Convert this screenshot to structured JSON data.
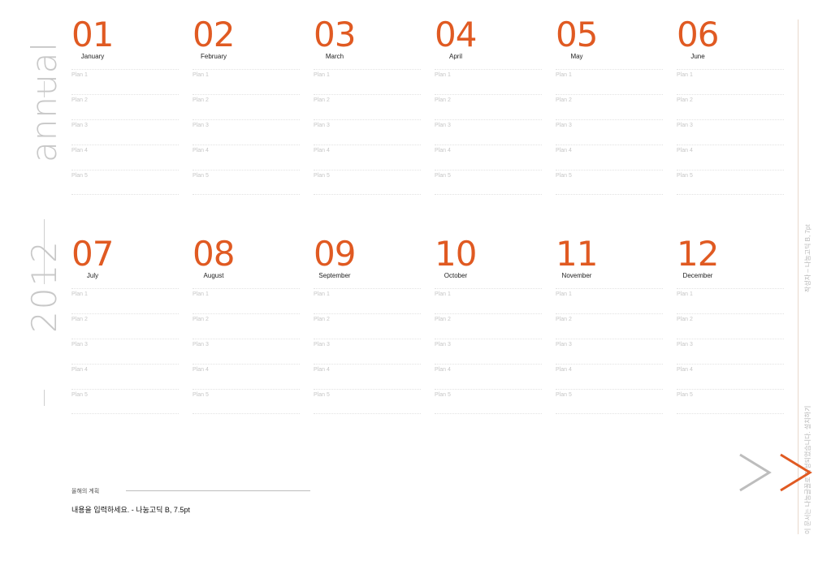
{
  "sidebar": {
    "word": "annual",
    "year": "2012"
  },
  "months": [
    {
      "num": "01",
      "name": "January"
    },
    {
      "num": "02",
      "name": "February"
    },
    {
      "num": "03",
      "name": "March"
    },
    {
      "num": "04",
      "name": "April"
    },
    {
      "num": "05",
      "name": "May"
    },
    {
      "num": "06",
      "name": "June"
    },
    {
      "num": "07",
      "name": "July"
    },
    {
      "num": "08",
      "name": "August"
    },
    {
      "num": "09",
      "name": "September"
    },
    {
      "num": "10",
      "name": "October"
    },
    {
      "num": "11",
      "name": "November"
    },
    {
      "num": "12",
      "name": "December"
    }
  ],
  "plan_labels": [
    "Plan 1",
    "Plan 2",
    "Plan 3",
    "Plan 4",
    "Plan 5"
  ],
  "note": {
    "title": "올해의 계획",
    "body": "내용을 입력하세요. - 나눔고딕 B, 7.5pt"
  },
  "right": {
    "author": "작성자 – 나눔고딕 B, 7pt",
    "credit": "이 문서는 나눔글꼴로 작성되었습니다. 설치하기"
  },
  "colors": {
    "accent": "#e05a22",
    "muted": "#c8c8c8",
    "chevron_gray": "#bdbdbd"
  },
  "icons": [
    "chevron-right-icon",
    "chevron-right-icon"
  ]
}
